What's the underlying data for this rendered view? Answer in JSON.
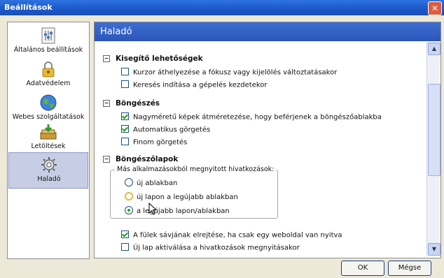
{
  "window": {
    "title": "Beállítások",
    "close_label": "✕"
  },
  "sidebar": {
    "items": [
      {
        "label": "Általános beállítások",
        "icon": "general-settings-icon"
      },
      {
        "label": "Adatvédelem",
        "icon": "privacy-lock-icon"
      },
      {
        "label": "Webes szolgáltatások",
        "icon": "globe-icon"
      },
      {
        "label": "Letöltések",
        "icon": "downloads-icon"
      },
      {
        "label": "Haladó",
        "icon": "gear-icon",
        "selected": true
      }
    ]
  },
  "main": {
    "header": "Haladó",
    "sections": [
      {
        "title": "Kisegítő lehetőségek",
        "toggle": "−",
        "options": [
          {
            "label": "Kurzor áthelyezése a fókusz vagy kijelölés változtatásakor",
            "checked": false
          },
          {
            "label": "Keresés indítása a gépelés kezdetekor",
            "checked": false
          }
        ]
      },
      {
        "title": "Böngészés",
        "toggle": "−",
        "options": [
          {
            "label": "Nagyméretű képek átméretezése, hogy beférjenek a böngészőablakba",
            "checked": true
          },
          {
            "label": "Automatikus görgetés",
            "checked": true
          },
          {
            "label": "Finom görgetés",
            "checked": false
          }
        ]
      },
      {
        "title": "Böngészőlapok",
        "toggle": "−",
        "group_legend": "Más alkalmazásokból megnyitott hivatkozások:",
        "radios": [
          {
            "label": "új ablakban",
            "selected": false
          },
          {
            "label": "új lapon a legújabb ablakban",
            "selected": false
          },
          {
            "label": "a legújabb lapon/ablakban",
            "selected": true
          }
        ],
        "options": [
          {
            "label": "A fülek sávjának elrejtése, ha csak egy weboldal van nyitva",
            "checked": true
          },
          {
            "label": "Új lap aktiválása a hivatkozások megnyitásakor",
            "checked": false
          }
        ]
      }
    ]
  },
  "buttons": {
    "ok": "OK",
    "cancel": "Mégse"
  },
  "colors": {
    "titlebar": "#1b56c8",
    "header": "#2b55b8",
    "check": "#21a121",
    "selected_item": "#c8cde6"
  }
}
